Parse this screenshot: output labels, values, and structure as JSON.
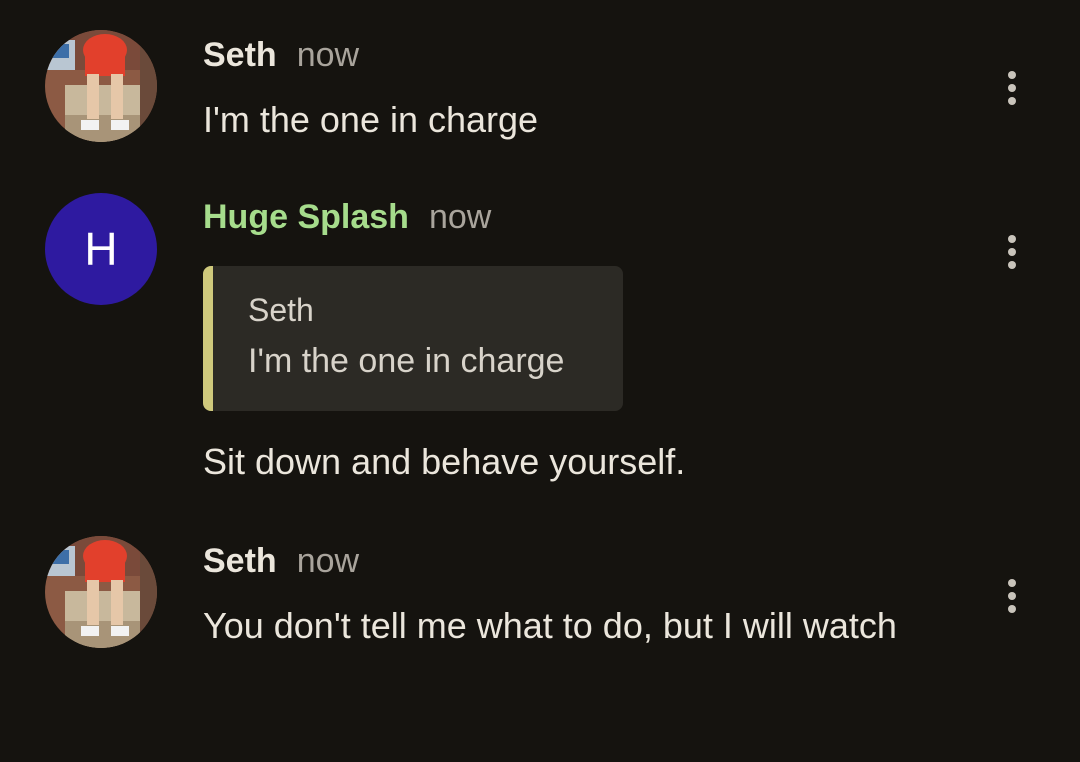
{
  "messages": [
    {
      "author": "Seth",
      "time": "now",
      "text": "I'm the one in charge",
      "avatar": "photo"
    },
    {
      "author": "Huge Splash",
      "time": "now",
      "avatar_letter": "H",
      "avatar_color": "#2e1aa0",
      "quote": {
        "author": "Seth",
        "text": "I'm the one in charge"
      },
      "text": "Sit down and behave yourself."
    },
    {
      "author": "Seth",
      "time": "now",
      "text": "You don't tell me what to do, but I will watch",
      "avatar": "photo"
    }
  ],
  "icons": {
    "more": "more-vert-icon"
  },
  "colors": {
    "background": "#15130f",
    "name_highlight": "#a6dc8c",
    "quote_bar": "#cfc97c"
  }
}
